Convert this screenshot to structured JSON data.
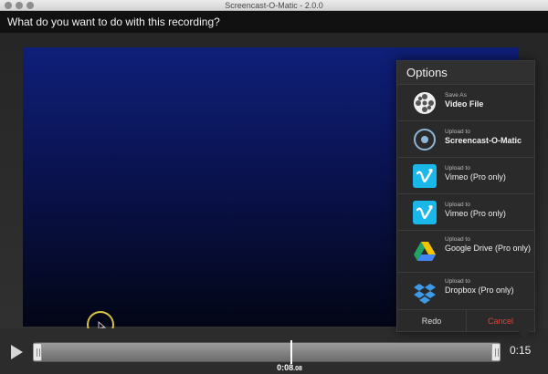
{
  "window": {
    "title": "Screencast-O-Matic - 2.0.0"
  },
  "prompt": {
    "question": "What do you want to do with this recording?"
  },
  "options_panel": {
    "title": "Options",
    "items": [
      {
        "small": "Save As",
        "big": "Video File",
        "icon": "film-reel-icon"
      },
      {
        "small": "Upload to",
        "big": "Screencast-O-Matic",
        "icon": "screencast-o-matic-icon"
      },
      {
        "small": "Upload to",
        "big": "Vimeo (Pro only)",
        "icon": "vimeo-icon"
      },
      {
        "small": "Upload to",
        "big": "Vimeo (Pro only)",
        "icon": "vimeo-icon"
      },
      {
        "small": "Upload to",
        "big": "Google Drive (Pro only)",
        "icon": "google-drive-icon"
      },
      {
        "small": "Upload to",
        "big": "Dropbox (Pro only)",
        "icon": "dropbox-icon"
      }
    ],
    "redo_label": "Redo",
    "cancel_label": "Cancel"
  },
  "timeline": {
    "playhead_main": "0:08",
    "playhead_fraction": ".08",
    "end_time": "0:15",
    "playhead_progress": 0.55
  },
  "colors": {
    "cancel": "#e0443a",
    "vimeo": "#1ab7ea",
    "cursor_ring": "#d8c341"
  }
}
